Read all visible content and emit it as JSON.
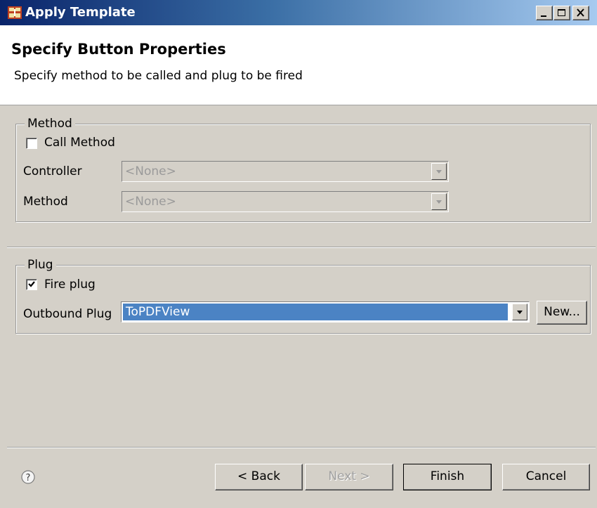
{
  "window": {
    "title": "Apply Template"
  },
  "header": {
    "title": "Specify Button Properties",
    "description": "Specify method to be called and plug to be fired"
  },
  "method_group": {
    "legend": "Method",
    "call_method_label": "Call Method",
    "call_method_checked": false,
    "controller_label": "Controller",
    "controller_value": "<None>",
    "method_label": "Method",
    "method_value": "<None>"
  },
  "plug_group": {
    "legend": "Plug",
    "fire_plug_label": "Fire plug",
    "fire_plug_checked": true,
    "outbound_plug_label": "Outbound Plug",
    "outbound_plug_value": "ToPDFView",
    "new_button_label": "New..."
  },
  "footer": {
    "back_label": "< Back",
    "next_label": "Next >",
    "finish_label": "Finish",
    "cancel_label": "Cancel"
  },
  "icons": {
    "app": "template-icon",
    "help": "help-icon",
    "minimize": "minimize-icon",
    "maximize": "maximize-icon",
    "close": "close-icon"
  },
  "colors": {
    "titlebar_start": "#0a246a",
    "titlebar_end": "#a6caf0",
    "selection": "#4b83c4",
    "dialog_bg": "#d4d0c8"
  }
}
